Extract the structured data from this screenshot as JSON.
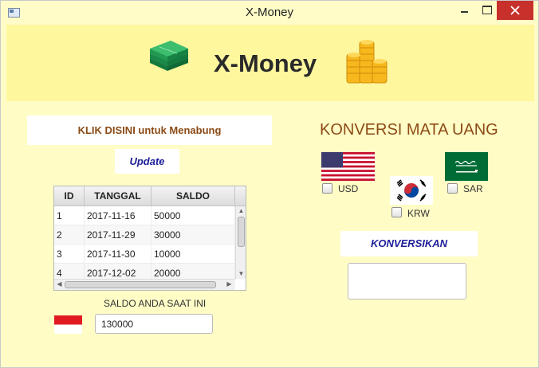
{
  "window": {
    "title": "X-Money"
  },
  "header": {
    "brand": "X-Money"
  },
  "savings": {
    "save_button": "KLIK DISINI untuk Menabung",
    "update_button": "Update"
  },
  "table": {
    "columns": [
      "ID",
      "TANGGAL",
      "SALDO"
    ],
    "rows": [
      {
        "id": "1",
        "tanggal": "2017-11-16",
        "saldo": "50000"
      },
      {
        "id": "2",
        "tanggal": "2017-11-29",
        "saldo": "30000"
      },
      {
        "id": "3",
        "tanggal": "2017-11-30",
        "saldo": "10000"
      },
      {
        "id": "4",
        "tanggal": "2017-12-02",
        "saldo": "20000"
      }
    ]
  },
  "balance": {
    "label": "SALDO ANDA SAAT INI",
    "value": "130000"
  },
  "conversion": {
    "title": "KONVERSI MATA UANG",
    "currencies": [
      {
        "code": "USD",
        "flag": "us-flag-icon"
      },
      {
        "code": "KRW",
        "flag": "kr-flag-icon"
      },
      {
        "code": "SAR",
        "flag": "sa-flag-icon"
      }
    ],
    "convert_button": "KONVERSIKAN",
    "result": ""
  },
  "colors": {
    "header_bg": "#fff79d",
    "body_bg": "#fffcc6",
    "accent_brown": "#8e4b16",
    "accent_blue": "#1e1e9a",
    "close_red": "#c7302b"
  }
}
